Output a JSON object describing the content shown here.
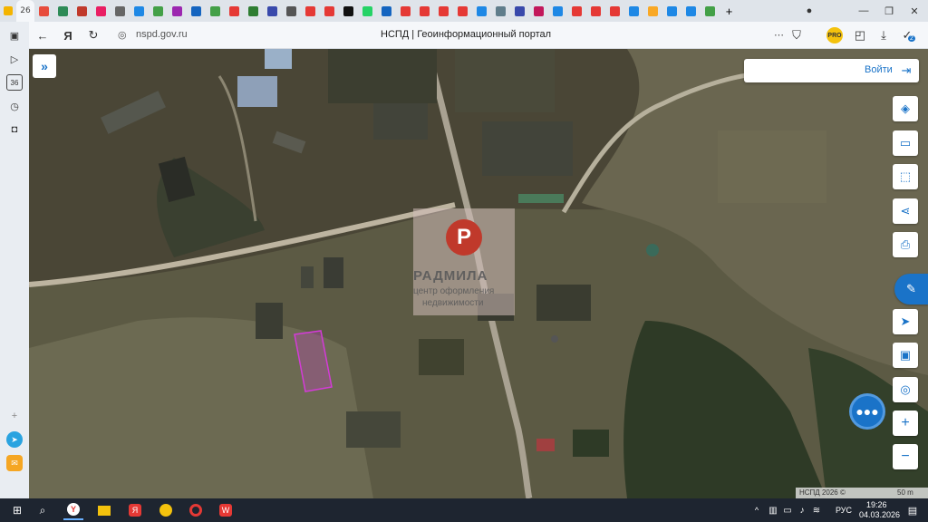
{
  "browser": {
    "tab_count_badge": "26",
    "tab_colors": [
      "#e74c3c",
      "#2e8b57",
      "#c0392b",
      "#e91e63",
      "#666",
      "#1e88e5",
      "#43a047",
      "#9c27b0",
      "#1565c0",
      "#43a047",
      "#e53935",
      "#2e7d32",
      "#3949ab",
      "#555",
      "#e53935",
      "#e53935",
      "#111",
      "#25d366",
      "#1565c0",
      "#e53935",
      "#e53935",
      "#e53935",
      "#e53935",
      "#1e88e5",
      "#607d8b",
      "#3949ab",
      "#c2185b",
      "#1e88e5",
      "#e53935",
      "#e53935",
      "#e53935",
      "#1e88e5",
      "#f9a825",
      "#1e88e5",
      "#1e88e5",
      "#43a047"
    ],
    "url": "nspd.gov.ru",
    "page_title": "НСПД | Геоинформационный портал",
    "notification_count": "2"
  },
  "map": {
    "login_label": "Войти",
    "watermark": {
      "name": "РАДМИЛА",
      "line1": "центр оформления",
      "line2": "недвижимости"
    },
    "scale_copyright": "НСПД 2026 ©",
    "scale_value": "50 m",
    "parcel_color": "#d43bd8"
  },
  "taskbar": {
    "time": "19:26",
    "date": "04.03.2026",
    "lang": "РУС"
  }
}
